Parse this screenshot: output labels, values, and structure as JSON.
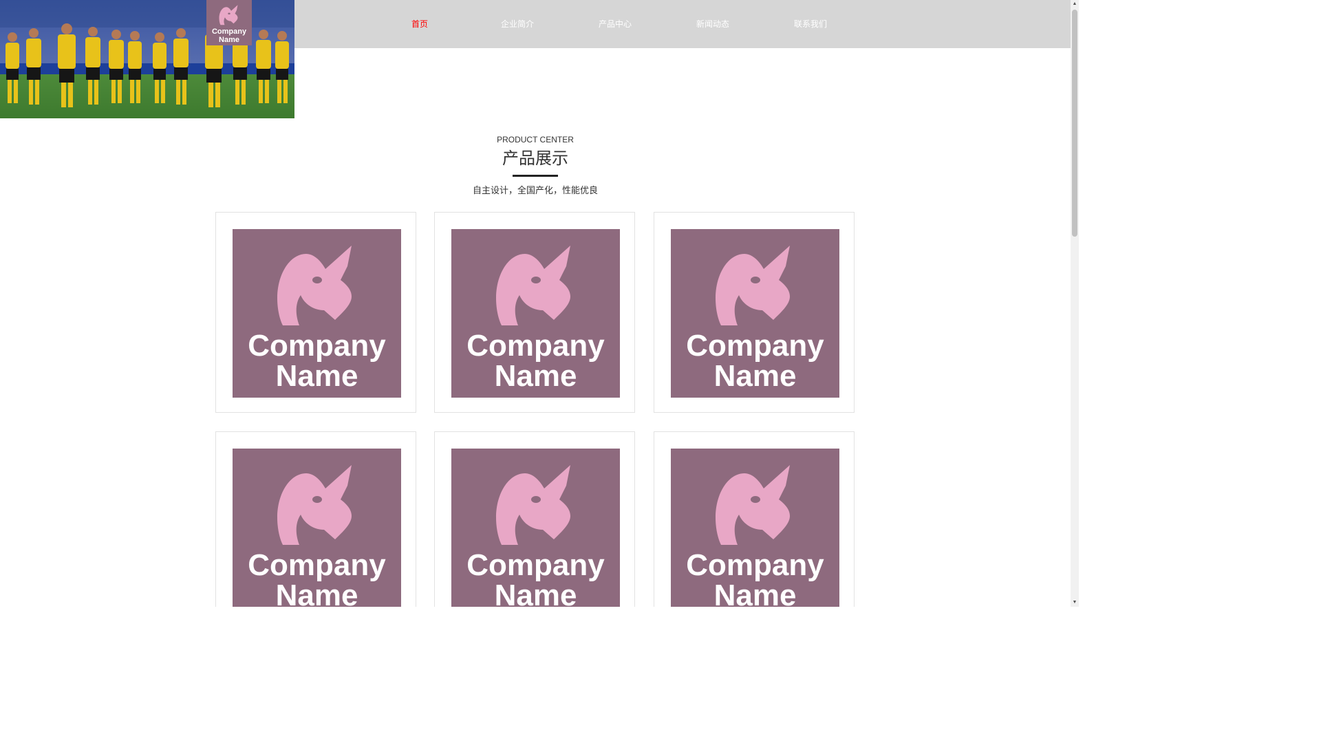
{
  "brand": {
    "logo_icon": "unicorn-icon",
    "name": "Company\nName",
    "logo_color": "#8e6a7e",
    "icon_color": "#e8a7c6"
  },
  "nav": {
    "items": [
      {
        "label": "首页",
        "active": true
      },
      {
        "label": "企业简介",
        "active": false
      },
      {
        "label": "产品中心",
        "active": false
      },
      {
        "label": "新闻动态",
        "active": false
      },
      {
        "label": "联系我们",
        "active": false
      }
    ],
    "active_color": "#ff0000",
    "background": "#d6d6d6"
  },
  "section": {
    "subtitle_en": "PRODUCT CENTER",
    "title": "产品展示",
    "description": "自主设计，全国产化，性能优良"
  },
  "products": [
    {
      "name": "Company\nName",
      "icon": "unicorn-icon"
    },
    {
      "name": "Company\nName",
      "icon": "unicorn-icon"
    },
    {
      "name": "Company\nName",
      "icon": "unicorn-icon"
    },
    {
      "name": "Company\nName",
      "icon": "unicorn-icon"
    },
    {
      "name": "Company\nName",
      "icon": "unicorn-icon"
    },
    {
      "name": "Company\nName",
      "icon": "unicorn-icon"
    }
  ]
}
